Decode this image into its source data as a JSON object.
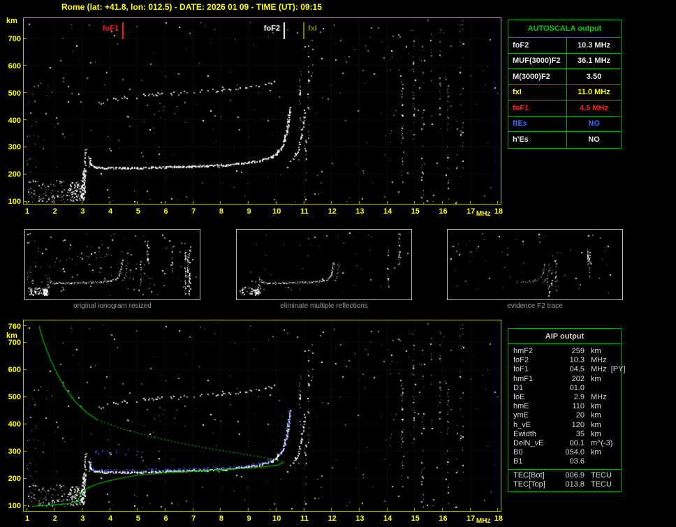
{
  "header": {
    "title": "Rome (lat: +41.8, lon: 012.5) - DATE: 2026 01 09 - TIME (UT): 09:15"
  },
  "autoscala_table": {
    "title": "AUTOSCALA output",
    "rows": [
      {
        "label": "foF2",
        "value": "10.3 MHz",
        "color": "white"
      },
      {
        "label": "MUF(3000)F2",
        "value": "36.1 MHz",
        "color": "white"
      },
      {
        "label": "M(3000)F2",
        "value": "3.50",
        "color": "white"
      },
      {
        "label": "fxI",
        "value": "11.0 MHz",
        "color": "yellow"
      },
      {
        "label": "foF1",
        "value": "4.5 MHz",
        "color": "red"
      },
      {
        "label": "ftEs",
        "value": "NO",
        "color": "blue"
      },
      {
        "label": "h'Es",
        "value": "NO",
        "color": "white"
      }
    ]
  },
  "aip_table": {
    "title": "AIP output",
    "rows": [
      {
        "label": "hmF2",
        "value": "259",
        "unit": "km"
      },
      {
        "label": "foF2",
        "value": "10.3",
        "unit": "MHz"
      },
      {
        "label": "foF1",
        "value": "04.5",
        "unit": "MHz",
        "note": "[PY]"
      },
      {
        "label": "hmF1",
        "value": "202",
        "unit": "km"
      },
      {
        "label": "D1",
        "value": "01.0",
        "unit": ""
      },
      {
        "label": "foE",
        "value": "2.9",
        "unit": "MHz"
      },
      {
        "label": "hmE",
        "value": "110",
        "unit": "km"
      },
      {
        "label": "ymE",
        "value": "20",
        "unit": "km"
      },
      {
        "label": "h_vE",
        "value": "120",
        "unit": "km"
      },
      {
        "label": "Ewidth",
        "value": "35",
        "unit": "km"
      },
      {
        "label": "DelN_vE",
        "value": "00.1",
        "unit": "m^(-3)"
      },
      {
        "label": "B0",
        "value": "054.0",
        "unit": "km"
      },
      {
        "label": "B1",
        "value": "03.6",
        "unit": ""
      }
    ],
    "tec_rows": [
      {
        "label": "TEC[Bot]",
        "value": "006.9",
        "unit": "TECU"
      },
      {
        "label": "TEC[Top]",
        "value": "013.8",
        "unit": "TECU"
      }
    ]
  },
  "thumbnails": [
    {
      "caption": "original ionogram resized"
    },
    {
      "caption": "eliminate multiple reflections"
    },
    {
      "caption": "evidence F2 trace"
    }
  ],
  "chart_data": [
    {
      "id": "ionogram-top",
      "type": "scatter",
      "title": "Recorded ionogram with AUTOSCALA markers",
      "xlabel": "MHz",
      "ylabel": "km",
      "xlim": [
        1,
        18
      ],
      "ylim": [
        80,
        780
      ],
      "xticks": [
        1,
        2,
        3,
        4,
        5,
        6,
        7,
        8,
        9,
        10,
        11,
        12,
        13,
        14,
        15,
        16,
        17,
        18
      ],
      "yticks": [
        700,
        600,
        500,
        400,
        300,
        200,
        100
      ],
      "grid": true,
      "markers": [
        {
          "name": "foF1",
          "freq_mhz": 4.5,
          "color": "#ff2222",
          "side": "left"
        },
        {
          "name": "foF2",
          "freq_mhz": 10.3,
          "color": "#ffffff",
          "side": "left"
        },
        {
          "name": "fxI",
          "freq_mhz": 11.0,
          "color": "#8a8a00",
          "side": "right"
        }
      ],
      "traces": {
        "f_trace": [
          [
            3.25,
            262
          ],
          [
            3.3,
            238
          ],
          [
            3.45,
            227
          ],
          [
            3.8,
            222
          ],
          [
            4.5,
            222
          ],
          [
            5.5,
            224
          ],
          [
            6.5,
            227
          ],
          [
            7.5,
            230
          ],
          [
            8.3,
            234
          ],
          [
            9.0,
            242
          ],
          [
            9.5,
            251
          ],
          [
            9.85,
            263
          ],
          [
            10.05,
            278
          ],
          [
            10.2,
            298
          ],
          [
            10.3,
            325
          ],
          [
            10.38,
            358
          ],
          [
            10.44,
            395
          ],
          [
            10.48,
            428
          ],
          [
            10.5,
            445
          ]
        ],
        "x_trace": [
          [
            10.52,
            248
          ],
          [
            10.62,
            258
          ],
          [
            10.72,
            274
          ],
          [
            10.82,
            300
          ],
          [
            10.9,
            335
          ],
          [
            10.96,
            372
          ],
          [
            11.0,
            408
          ],
          [
            11.03,
            438
          ]
        ],
        "second_hop": [
          [
            3.55,
            458
          ],
          [
            3.9,
            472
          ],
          [
            4.4,
            481
          ],
          [
            5.0,
            488
          ],
          [
            5.7,
            493
          ],
          [
            6.4,
            498
          ],
          [
            7.1,
            503
          ],
          [
            7.8,
            508
          ],
          [
            8.5,
            515
          ],
          [
            9.1,
            523
          ],
          [
            9.6,
            533
          ],
          [
            9.95,
            543
          ]
        ],
        "e_spike_lower": [
          [
            3.02,
            112
          ],
          [
            3.08,
            210
          ]
        ],
        "e_spike_upper": [
          [
            3.08,
            210
          ],
          [
            3.12,
            292
          ]
        ],
        "es_region": [
          1.05,
          3.0,
          96,
          178
        ],
        "es_dense": [
          2.55,
          3.05,
          102,
          162
        ],
        "left_region": [
          1.0,
          1.4,
          100,
          470
        ]
      }
    },
    {
      "id": "ionogram-bottom",
      "type": "scatter",
      "title": "Ionogram with restored trace and electron density profile",
      "xlabel": "MHz",
      "ylabel": "km",
      "xlim": [
        1,
        18
      ],
      "ylim": [
        80,
        780
      ],
      "yticks": [
        760,
        700,
        600,
        500,
        400,
        300,
        200,
        100
      ],
      "grid": true,
      "profile_color": "#00bb00",
      "restored_trace_color": "#3c50ff",
      "profile": {
        "topside_solid": [
          [
            1.45,
            760
          ],
          [
            1.62,
            700
          ],
          [
            1.85,
            640
          ],
          [
            2.1,
            585
          ],
          [
            2.4,
            530
          ],
          [
            2.75,
            483
          ],
          [
            3.15,
            443
          ],
          [
            3.55,
            415
          ]
        ],
        "topside_dotted": [
          [
            3.55,
            415
          ],
          [
            4.4,
            383
          ],
          [
            5.4,
            356
          ],
          [
            6.5,
            330
          ],
          [
            7.7,
            307
          ],
          [
            8.9,
            287
          ],
          [
            9.8,
            272
          ],
          [
            10.25,
            261
          ]
        ],
        "bottomside_solid": [
          [
            10.3,
            259
          ],
          [
            10.05,
            248
          ],
          [
            9.4,
            240
          ],
          [
            8.4,
            233
          ],
          [
            7.2,
            227
          ],
          [
            5.9,
            219
          ],
          [
            5.0,
            211
          ],
          [
            4.5,
            202
          ],
          [
            4.0,
            191
          ],
          [
            3.55,
            179
          ],
          [
            3.2,
            164
          ],
          [
            3.0,
            148
          ],
          [
            2.9,
            130
          ],
          [
            2.87,
            114
          ],
          [
            2.6,
            107
          ],
          [
            2.1,
            103
          ],
          [
            1.6,
            99
          ],
          [
            1.25,
            97
          ]
        ]
      },
      "restored_extra": [
        [
          3.25,
          296
        ],
        [
          3.7,
          303
        ],
        [
          4.2,
          301
        ],
        [
          4.7,
          297
        ],
        [
          5.2,
          292
        ]
      ]
    },
    {
      "id": "thumb-original",
      "type": "scatter",
      "title": "original ionogram resized"
    },
    {
      "id": "thumb-cleaned",
      "type": "scatter",
      "title": "eliminate multiple reflections"
    },
    {
      "id": "thumb-f2",
      "type": "scatter",
      "title": "evidence F2 trace"
    }
  ]
}
